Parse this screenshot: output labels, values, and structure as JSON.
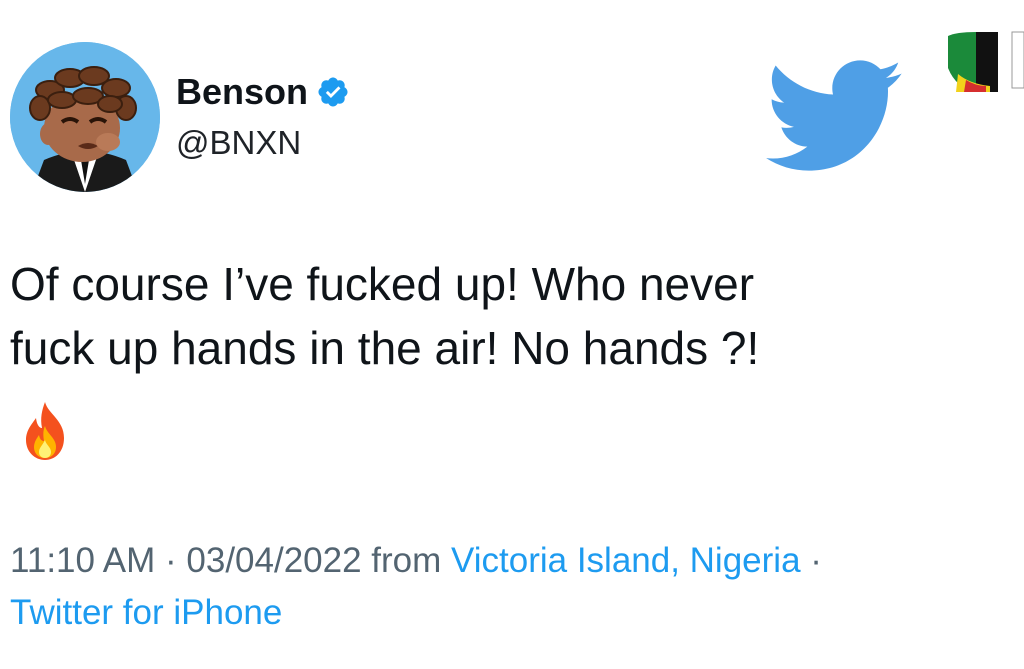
{
  "tweet": {
    "author": {
      "display_name": "Benson",
      "handle": "@BNXN",
      "verified": true,
      "avatar_icon": "cartoon-avatar"
    },
    "text_lines": [
      "Of course I’ve fucked up! Who never",
      "fuck up hands in the air! No hands ?!"
    ],
    "emoji": "🔥",
    "meta": {
      "time": "11:10 AM",
      "separator_1": " · ",
      "date": "03/04/2022",
      "from_label": " from ",
      "location": "Victoria Island, Nigeria",
      "separator_2": " ·",
      "source": "Twitter for iPhone"
    }
  },
  "icons": {
    "logo": "twitter-bird-icon",
    "verified": "verified-badge-icon",
    "emoji": "fire-icon"
  },
  "colors": {
    "brand_blue": "#1d9bf0",
    "logo_blue": "#4f9fe6",
    "text_primary": "#0f1419",
    "text_secondary": "#536471",
    "avatar_bg": "#67b7ea"
  }
}
